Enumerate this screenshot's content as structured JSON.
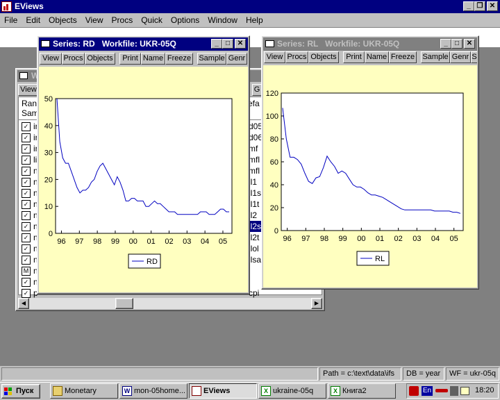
{
  "app": {
    "title": "EViews",
    "menu": [
      "File",
      "Edit",
      "Objects",
      "View",
      "Procs",
      "Quick",
      "Options",
      "Window",
      "Help"
    ]
  },
  "back_window": {
    "title": "W",
    "toolbar": [
      "View"
    ],
    "side_toolbar": "G",
    "info_rows": [
      "Ran",
      "Sam"
    ],
    "info_right": [
      "efa",
      ""
    ],
    "items": [
      {
        "label": "ir",
        "right": "d05"
      },
      {
        "label": "ir",
        "right": "d06"
      },
      {
        "label": "ir",
        "right": "mf"
      },
      {
        "label": "li",
        "right": "mfl"
      },
      {
        "label": "n",
        "right": "mfl"
      },
      {
        "label": "n",
        "right": "il1"
      },
      {
        "label": "n",
        "right": "il1s"
      },
      {
        "label": "n",
        "right": "il1t"
      },
      {
        "label": "n",
        "right": "il2"
      },
      {
        "label": "n",
        "right": "il2s"
      },
      {
        "label": "n",
        "right": "il2t"
      },
      {
        "label": "n",
        "right": "ilol"
      },
      {
        "label": "n",
        "right": "ilsa"
      },
      {
        "label": "n",
        "right": ""
      },
      {
        "label": "n",
        "right": ""
      },
      {
        "label": "p",
        "right": "cpi"
      }
    ]
  },
  "window_rd": {
    "title": "Series: RD   Workfile: UKR-05Q",
    "toolbar": [
      "View",
      "Procs",
      "Objects",
      "Print",
      "Name",
      "Freeze",
      "Sample",
      "Genr"
    ],
    "legend": "RD"
  },
  "window_rl": {
    "title": "Series: RL   Workfile: UKR-05Q",
    "toolbar": [
      "View",
      "Procs",
      "Objects",
      "Print",
      "Name",
      "Freeze",
      "Sample",
      "Genr",
      "S"
    ],
    "legend": "RL"
  },
  "status_bar": {
    "path": "Path = c:\\text\\data\\ifs",
    "db": "DB = year",
    "wf": "WF = ukr-05q"
  },
  "taskbar": {
    "start": "Пуск",
    "tasks": [
      "Monetary",
      "mon-05home...",
      "EViews",
      "ukraine-05q",
      "Книга2"
    ],
    "tray_lang": "En",
    "clock": "18:20"
  },
  "chart_data": [
    {
      "type": "line",
      "series": [
        {
          "name": "RD",
          "values": [
            50,
            34,
            28,
            26,
            26,
            23,
            20,
            17,
            15,
            16,
            16,
            17,
            19,
            20,
            23,
            25,
            26,
            24,
            22,
            20,
            18,
            21,
            19,
            16,
            12,
            12,
            13,
            13,
            12,
            12,
            12,
            10,
            10,
            11,
            12,
            11,
            11,
            10,
            9,
            8,
            8,
            8,
            7,
            7,
            7,
            7,
            7,
            7,
            7,
            7,
            8,
            8,
            8,
            7,
            7,
            7,
            8,
            9,
            9,
            8,
            8
          ]
        }
      ],
      "x_start": 1995.75,
      "x_step": 0.16,
      "xticks": [
        "96",
        "97",
        "98",
        "99",
        "00",
        "01",
        "02",
        "03",
        "04",
        "05"
      ],
      "yticks": [
        0,
        10,
        20,
        30,
        40,
        50
      ],
      "ylim": [
        0,
        50
      ]
    },
    {
      "type": "line",
      "series": [
        {
          "name": "RL",
          "values": [
            107,
            80,
            64,
            64,
            62,
            58,
            50,
            43,
            41,
            46,
            47,
            55,
            65,
            60,
            56,
            50,
            52,
            50,
            45,
            40,
            38,
            38,
            36,
            33,
            31,
            31,
            30,
            29,
            27,
            25,
            23,
            21,
            19,
            18,
            18,
            18,
            18,
            18,
            18,
            18,
            18,
            17,
            17,
            17,
            17,
            17,
            16,
            16,
            15
          ]
        }
      ],
      "x_start": 1995.75,
      "x_step": 0.2,
      "xticks": [
        "96",
        "97",
        "98",
        "99",
        "00",
        "01",
        "02",
        "03",
        "04",
        "05"
      ],
      "yticks": [
        0,
        20,
        40,
        60,
        80,
        100,
        120
      ],
      "ylim": [
        0,
        120
      ]
    }
  ]
}
